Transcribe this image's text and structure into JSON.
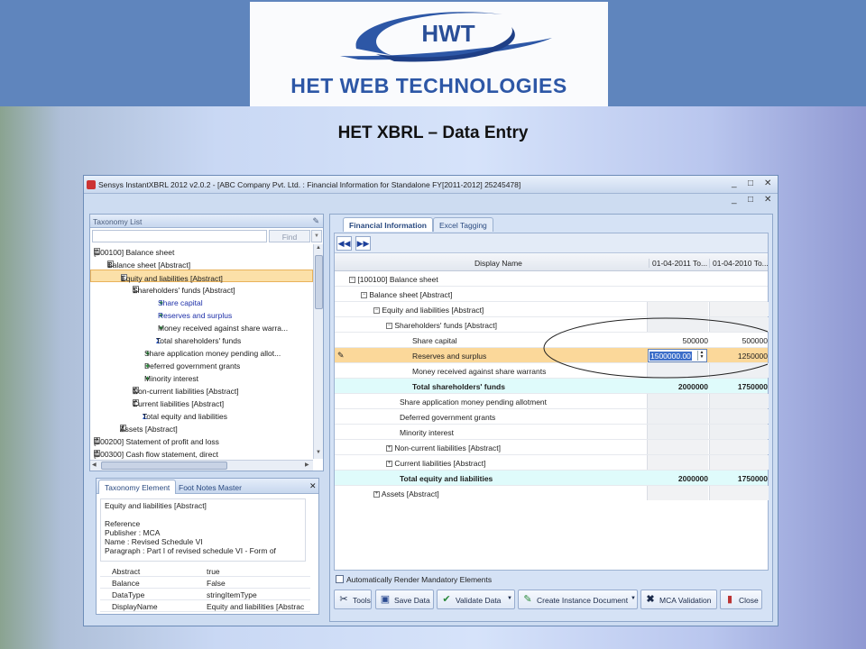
{
  "banner": {
    "logo_mark": "HWT",
    "logo_text": "HET WEB TECHNOLOGIES",
    "slide_title": "HET XBRL – Data Entry"
  },
  "window": {
    "title": "Sensys InstantXBRL 2012 v2.0.2 - [ABC Company Pvt. Ltd. : Financial Information for Standalone FY[2011-2012] 25245478]",
    "min": "_",
    "max": "□",
    "close": "✕"
  },
  "taxonomy_list": {
    "header": "Taxonomy List",
    "find_label": "Find",
    "rows": [
      {
        "label": "[100100] Balance sheet"
      },
      {
        "label": "Balance sheet [Abstract]"
      },
      {
        "label": "Equity and liabilities [Abstract]"
      },
      {
        "label": "Shareholders' funds [Abstract]"
      },
      {
        "label": "Share capital"
      },
      {
        "label": "Reserves and surplus"
      },
      {
        "label": "Money received against share warra..."
      },
      {
        "label": "Total shareholders' funds"
      },
      {
        "label": "Share application money pending allot..."
      },
      {
        "label": "Deferred government grants"
      },
      {
        "label": "Minority interest"
      },
      {
        "label": "Non-current liabilities [Abstract]"
      },
      {
        "label": "Current liabilities [Abstract]"
      },
      {
        "label": "Total equity and liabilities"
      },
      {
        "label": "Assets [Abstract]"
      },
      {
        "label": "[100200] Statement of profit and loss"
      },
      {
        "label": "[100300] Cash flow statement, direct"
      }
    ]
  },
  "element_panel": {
    "tabs": [
      "Taxonomy Element",
      "Foot Notes Master"
    ],
    "title": "Equity and liabilities [Abstract]",
    "lines": [
      "Reference",
      "Publisher : MCA",
      "Name : Revised Schedule VI",
      "Paragraph : Part I of revised schedule VI - Form of"
    ],
    "props": [
      {
        "k": "Abstract",
        "v": "true"
      },
      {
        "k": "Balance",
        "v": "False"
      },
      {
        "k": "DataType",
        "v": "stringItemType"
      },
      {
        "k": "DisplayName",
        "v": "Equity and liabilities [Abstrac"
      }
    ]
  },
  "main": {
    "tabs": [
      "Financial Information",
      "Excel Tagging"
    ],
    "columns": [
      "Display Name",
      "01-04-2011 To...",
      "01-04-2010 To..."
    ],
    "rows": [
      {
        "label": "[100100] Balance sheet",
        "v1": "",
        "v2": ""
      },
      {
        "label": "Balance sheet [Abstract]",
        "v1": "",
        "v2": ""
      },
      {
        "label": "Equity and liabilities [Abstract]",
        "v1": "",
        "v2": ""
      },
      {
        "label": "Shareholders' funds [Abstract]",
        "v1": "",
        "v2": ""
      },
      {
        "label": "Share capital",
        "v1": "500000",
        "v2": "500000"
      },
      {
        "label": "Reserves and surplus",
        "v1": "1500000.00",
        "v2": "1250000"
      },
      {
        "label": "Money received against share warrants",
        "v1": "",
        "v2": ""
      },
      {
        "label": "Total shareholders' funds",
        "v1": "2000000",
        "v2": "1750000"
      },
      {
        "label": "Share application money pending allotment",
        "v1": "",
        "v2": ""
      },
      {
        "label": "Deferred government grants",
        "v1": "",
        "v2": ""
      },
      {
        "label": "Minority interest",
        "v1": "",
        "v2": ""
      },
      {
        "label": "Non-current liabilities [Abstract]",
        "v1": "",
        "v2": ""
      },
      {
        "label": "Current liabilities [Abstract]",
        "v1": "",
        "v2": ""
      },
      {
        "label": "Total equity and liabilities",
        "v1": "2000000",
        "v2": "1750000"
      },
      {
        "label": "Assets [Abstract]",
        "v1": "",
        "v2": ""
      }
    ],
    "auto_render": "Automatically Render Mandatory Elements",
    "buttons": [
      "Tools",
      "Save Data",
      "Validate Data",
      "Create Instance Document",
      "MCA Validation",
      "Close"
    ]
  }
}
